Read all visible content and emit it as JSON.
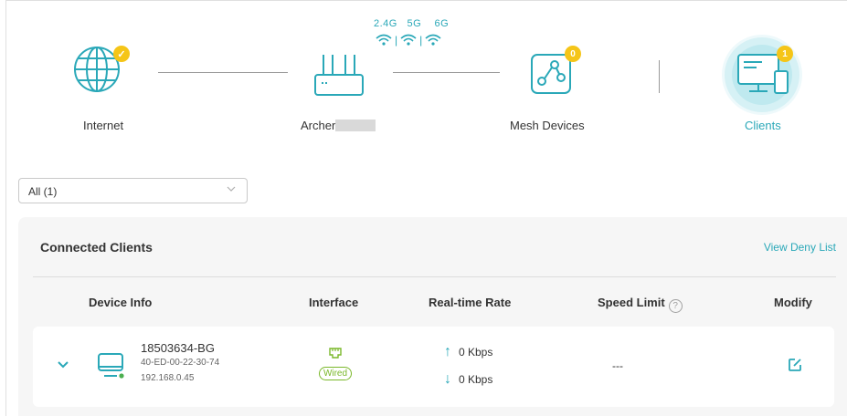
{
  "topology": {
    "internet": {
      "label": "Internet",
      "status": "connected"
    },
    "router": {
      "label": "Archer",
      "bands": [
        "2.4G",
        "5G",
        "6G"
      ]
    },
    "mesh": {
      "label": "Mesh Devices",
      "count": "0"
    },
    "clients": {
      "label": "Clients",
      "count": "1"
    }
  },
  "filter": {
    "value": "All (1)"
  },
  "panel": {
    "title": "Connected Clients",
    "deny_link": "View Deny List",
    "columns": {
      "device_info": "Device Info",
      "interface": "Interface",
      "rate": "Real-time Rate",
      "speed_limit": "Speed Limit",
      "modify": "Modify"
    },
    "help_glyph": "?",
    "rows": [
      {
        "name": "18503634-BG",
        "mac": "40-ED-00-22-30-74",
        "ip": "192.168.0.45",
        "interface": "Wired",
        "up": "0 Kbps",
        "down": "0 Kbps",
        "speed_limit": "---"
      }
    ]
  },
  "colors": {
    "accent": "#2aa8b8",
    "badge": "#f5c518",
    "wired": "#7ab82a"
  },
  "icons": [
    "globe-icon",
    "router-icon",
    "wifi-icon",
    "mesh-icon",
    "monitor-phone-icon",
    "chevron-down-icon",
    "edit-icon",
    "ethernet-icon"
  ]
}
